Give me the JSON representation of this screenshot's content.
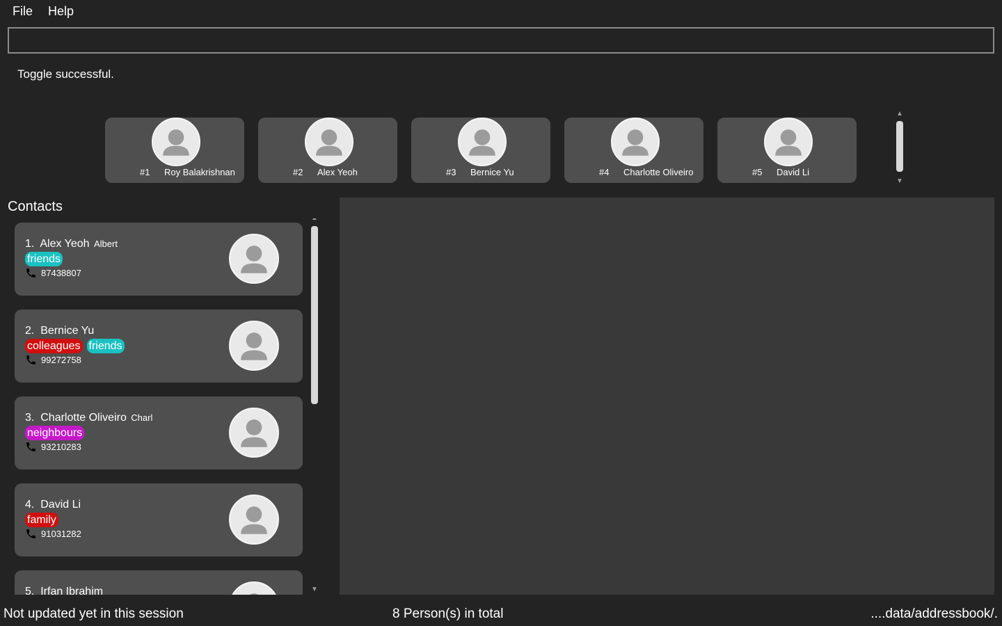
{
  "menu": {
    "file": "File",
    "help": "Help"
  },
  "command": {
    "value": "",
    "placeholder": ""
  },
  "result": {
    "message": "Toggle successful."
  },
  "favorites": [
    {
      "index": "#1",
      "name": "Roy Balakrishnan"
    },
    {
      "index": "#2",
      "name": "Alex Yeoh"
    },
    {
      "index": "#3",
      "name": "Bernice Yu"
    },
    {
      "index": "#4",
      "name": "Charlotte Oliveiro"
    },
    {
      "index": "#5",
      "name": "David Li"
    }
  ],
  "contacts": {
    "title": "Contacts",
    "items": [
      {
        "number": "1.",
        "name": "Alex Yeoh",
        "nickname": "Albert",
        "tags": [
          {
            "label": "friends",
            "color": "#1ac1c1"
          }
        ],
        "phone": "87438807"
      },
      {
        "number": "2.",
        "name": "Bernice Yu",
        "nickname": "",
        "tags": [
          {
            "label": "colleagues",
            "color": "#d10f0f"
          },
          {
            "label": "friends",
            "color": "#1ac1c1"
          }
        ],
        "phone": "99272758"
      },
      {
        "number": "3.",
        "name": "Charlotte Oliveiro",
        "nickname": "Charl",
        "tags": [
          {
            "label": "neighbours",
            "color": "#c419c8"
          }
        ],
        "phone": "93210283"
      },
      {
        "number": "4.",
        "name": "David Li",
        "nickname": "",
        "tags": [
          {
            "label": "family",
            "color": "#d10f0f"
          }
        ],
        "phone": "91031282"
      },
      {
        "number": "5.",
        "name": "Irfan Ibrahim",
        "nickname": "",
        "tags": [],
        "phone": ""
      }
    ]
  },
  "statusbar": {
    "sync": "Not updated yet in this session",
    "total": "8 Person(s) in total",
    "path": "....data/addressbook/."
  },
  "icons": {
    "avatar": "person-avatar-icon",
    "phone": "phone-icon",
    "scroll_up": "scroll-up-arrow-icon",
    "scroll_down": "scroll-down-arrow-icon"
  }
}
